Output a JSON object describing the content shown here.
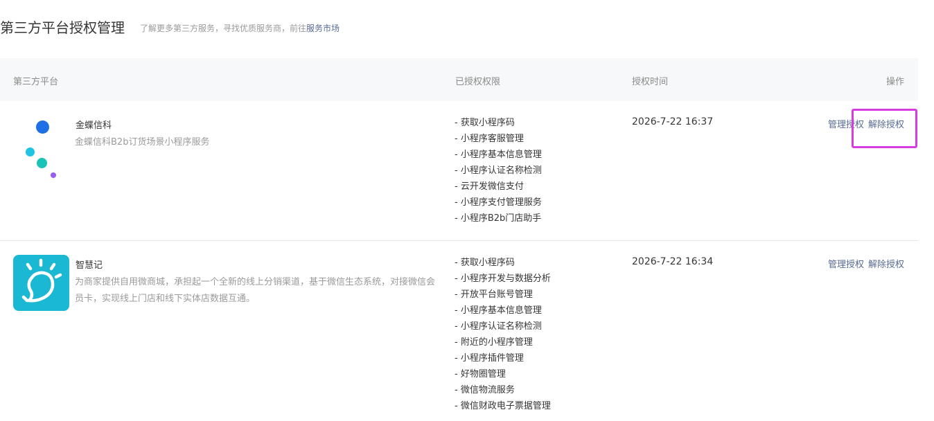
{
  "header": {
    "title": "第三方平台授权管理",
    "desc": "了解更多第三方服务，寻找优质服务商，前往",
    "market_link": "服务市场"
  },
  "table": {
    "columns": {
      "platform": "第三方平台",
      "permissions": "已授权权限",
      "time": "授权时间",
      "actions": "操作"
    },
    "rows": [
      {
        "name": "金蝶信科",
        "desc": "金蝶信科B2b订货场景小程序服务",
        "logo_icon": "kingdee-dots-logo-icon",
        "permissions": [
          "- 获取小程序码",
          "- 小程序客服管理",
          "- 小程序基本信息管理",
          "- 小程序认证名称检测",
          "- 云开发微信支付",
          "- 小程序支付管理服务",
          "- 小程序B2b门店助手"
        ],
        "time": "2026-7-22 16:37",
        "manage_label": "管理授权",
        "revoke_label": "解除授权"
      },
      {
        "name": "智慧记",
        "desc": "为商家提供自用微商城，承担起一个全新的线上分销渠道，基于微信生态系统，对接微信会员卡，实现线上门店和线下实体店数据互通。",
        "logo_icon": "zhihuiji-app-logo-icon",
        "permissions": [
          "- 获取小程序码",
          "- 小程序开发与数据分析",
          "- 开放平台账号管理",
          "- 小程序基本信息管理",
          "- 小程序认证名称检测",
          "- 附近的小程序管理",
          "- 小程序插件管理",
          "- 好物圈管理",
          "- 微信物流服务",
          "- 微信财政电子票据管理"
        ],
        "time": "2026-7-22 16:34",
        "manage_label": "管理授权",
        "revoke_label": "解除授权"
      }
    ]
  },
  "colors": {
    "link": "#576b95",
    "highlight": "#d63ce0",
    "header_bg": "#f6f8f9",
    "app_logo_bg": "#1ab8d3"
  }
}
